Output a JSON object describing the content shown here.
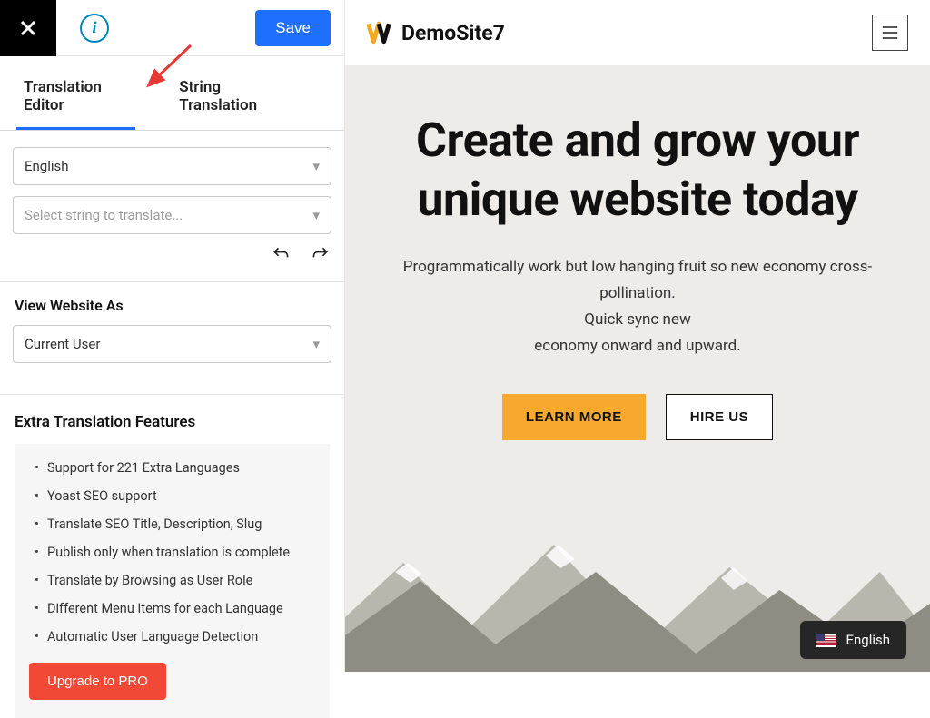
{
  "sidebar": {
    "save_label": "Save",
    "tabs": {
      "translation_editor": "Translation Editor",
      "string_translation": "String Translation"
    },
    "language_select": "English",
    "string_select_placeholder": "Select string to translate...",
    "view_as_label": "View Website As",
    "view_as_value": "Current User",
    "extra_title": "Extra Translation Features",
    "features": [
      "Support for 221 Extra Languages",
      "Yoast SEO support",
      "Translate SEO Title, Description, Slug",
      "Publish only when translation is complete",
      "Translate by Browsing as User Role",
      "Different Menu Items for each Language",
      "Automatic User Language Detection"
    ],
    "upgrade_label": "Upgrade to PRO"
  },
  "preview": {
    "site_name": "DemoSite7",
    "hero_title_1": "Create and grow your",
    "hero_title_2": "unique website today",
    "hero_sub_1": "Programmatically work but low hanging fruit so new economy cross-pollination.",
    "hero_sub_2": "Quick sync new",
    "hero_sub_3": "economy onward and upward.",
    "learn_more": "LEARN MORE",
    "hire_us": "HIRE US",
    "lang_pill": "English"
  }
}
